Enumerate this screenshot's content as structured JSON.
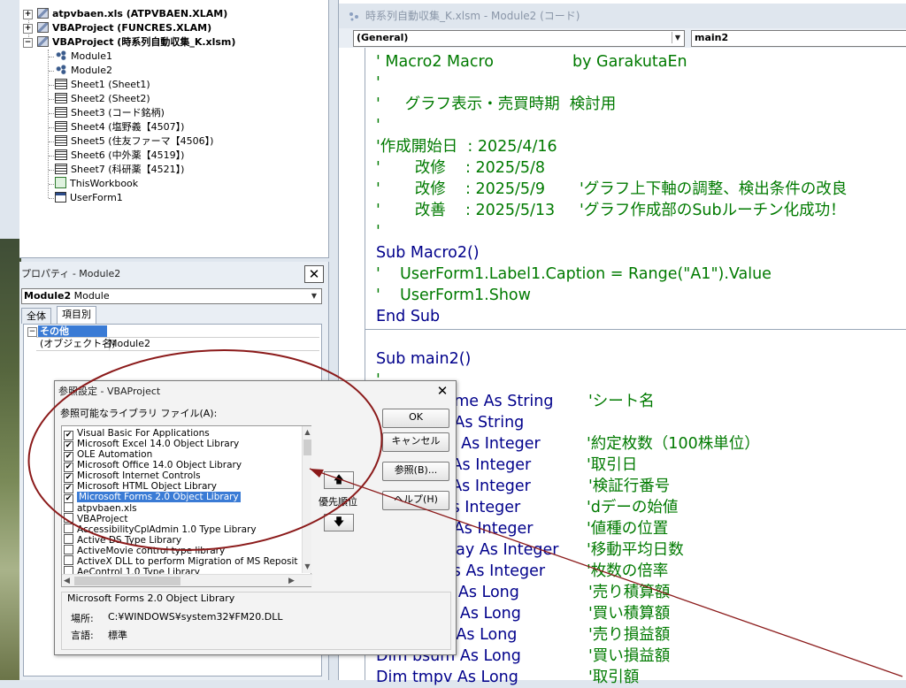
{
  "project_tree": {
    "projects": [
      {
        "label": "atpvbaen.xls (ATPVBAEN.XLAM)",
        "expander": "+"
      },
      {
        "label": "VBAProject (FUNCRES.XLAM)",
        "expander": "+"
      },
      {
        "label": "VBAProject (時系列自動収集_K.xlsm)",
        "expander": "−"
      }
    ],
    "items": [
      {
        "label": "Module1",
        "icon": "module-icon"
      },
      {
        "label": "Module2",
        "icon": "module-icon"
      },
      {
        "label": "Sheet1 (Sheet1)",
        "icon": "sheet-icon"
      },
      {
        "label": "Sheet2 (Sheet2)",
        "icon": "sheet-icon"
      },
      {
        "label": "Sheet3 (コード銘柄)",
        "icon": "sheet-icon"
      },
      {
        "label": "Sheet4 (塩野義【4507】)",
        "icon": "sheet-icon"
      },
      {
        "label": "Sheet5 (住友ファーマ【4506】)",
        "icon": "sheet-icon"
      },
      {
        "label": "Sheet6 (中外薬【4519】)",
        "icon": "sheet-icon"
      },
      {
        "label": "Sheet7 (科研薬【4521】)",
        "icon": "sheet-icon"
      },
      {
        "label": "ThisWorkbook",
        "icon": "workbook-icon"
      },
      {
        "label": "UserForm1",
        "icon": "userform-icon"
      }
    ]
  },
  "properties": {
    "title": "プロパティ - Module2",
    "close": "✕",
    "object_name": "Module2",
    "object_type": "Module",
    "tabs": [
      "全体",
      "項目別"
    ],
    "category": "その他",
    "category_expander": "−",
    "row_name": "(オブジェクト名)",
    "row_value": "Module2"
  },
  "code_window": {
    "title": "時系列自動収集_K.xlsm - Module2 (コード)",
    "object_combo": "(General)",
    "proc_combo": "main2",
    "lines": [
      {
        "text": "' Macro2 Macro                by GarakutaEn",
        "kind": "comment"
      },
      {
        "text": "'",
        "kind": "comment"
      },
      {
        "text": "'     グラフ表示・売買時期  検討用",
        "kind": "comment"
      },
      {
        "text": "'",
        "kind": "comment"
      },
      {
        "text": "'作成開始日  : 2025/4/16",
        "kind": "comment"
      },
      {
        "text": "'       改修    : 2025/5/8",
        "kind": "comment"
      },
      {
        "text": "'       改修    : 2025/5/9       'グラフ上下軸の調整、検出条件の改良",
        "kind": "comment"
      },
      {
        "text": "'       改善    : 2025/5/13     'グラフ作成部のSubルーチン化成功！",
        "kind": "comment"
      },
      {
        "text": "'",
        "kind": "comment"
      },
      {
        "text": "Sub Macro2()",
        "kind": "code"
      },
      {
        "text": "'    UserForm1.Label1.Caption = Range(\"A1\").Value",
        "kind": "comment"
      },
      {
        "text": "'    UserForm1.Show",
        "kind": "comment"
      },
      {
        "text": "End Sub",
        "kind": "code"
      },
      {
        "text": "Sub main2()",
        "kind": "code"
      },
      {
        "text": "'",
        "kind": "comment"
      },
      {
        "text": "Dim wsName As String",
        "kind": "code",
        "comment": "'シート名"
      },
      {
        "text": "Dim tmpt As String",
        "kind": "code",
        "comment": ""
      },
      {
        "text": "Dim vnum As Integer",
        "kind": "code",
        "comment": "'約定枚数（100株単位）"
      },
      {
        "text": "Dim tday As Integer",
        "kind": "code",
        "comment": "'取引日"
      },
      {
        "text": "Dim trow As Integer",
        "kind": "code",
        "comment": "'検証行番号"
      },
      {
        "text": "Dim dst As Integer",
        "kind": "code",
        "comment": "'dデーの始値"
      },
      {
        "text": "Dim vpos As Integer",
        "kind": "code",
        "comment": "'値種の位置"
      },
      {
        "text": "Dim mavday As Integer",
        "kind": "code",
        "comment": "'移動平均日数"
      },
      {
        "text": "Dim mtims As Integer",
        "kind": "code",
        "comment": "'枚数の倍率"
      },
      {
        "text": "Dim ssum As Long",
        "kind": "code",
        "comment": "'売り積算額"
      },
      {
        "text": "Dim bsum As Long",
        "kind": "code",
        "comment": "'買い積算額"
      },
      {
        "text": "Dim sprof As Long",
        "kind": "code",
        "comment": "'売り損益額"
      },
      {
        "text": "Dim bsum As Long",
        "kind": "code",
        "comment": "'買い損益額"
      },
      {
        "text": "Dim tmpv As Long",
        "kind": "code",
        "comment": "'取引額"
      }
    ]
  },
  "references_dialog": {
    "title": "参照設定 - VBAProject",
    "close": "✕",
    "list_label": "参照可能なライブラリ ファイル(A):",
    "references": [
      {
        "name": "Visual Basic For Applications",
        "checked": true
      },
      {
        "name": "Microsoft Excel 14.0 Object Library",
        "checked": true
      },
      {
        "name": "OLE Automation",
        "checked": true
      },
      {
        "name": "Microsoft Office 14.0 Object Library",
        "checked": true
      },
      {
        "name": "Microsoft Internet Controls",
        "checked": true
      },
      {
        "name": "Microsoft HTML Object Library",
        "checked": true
      },
      {
        "name": "Microsoft Forms 2.0 Object Library",
        "checked": true,
        "selected": true
      },
      {
        "name": "atpvbaen.xls",
        "checked": false
      },
      {
        "name": "VBAProject",
        "checked": false
      },
      {
        "name": "AccessibilityCplAdmin 1.0 Type Library",
        "checked": false
      },
      {
        "name": "Active DS Type Library",
        "checked": false
      },
      {
        "name": "ActiveMovie control type library",
        "checked": false
      },
      {
        "name": "ActiveX DLL to perform Migration of MS Reposit",
        "checked": false
      },
      {
        "name": "AeControl 1.0 Type Library",
        "checked": false
      }
    ],
    "buttons": {
      "ok": "OK",
      "cancel": "キャンセル",
      "browse": "参照(B)...",
      "help": "ヘルプ(H)"
    },
    "priority_label": "優先順位",
    "priority_up": "🡅",
    "priority_down": "🡇",
    "selected_group_title": "Microsoft Forms 2.0 Object Library",
    "location_label": "場所:",
    "location_value": "C:¥WINDOWS¥system32¥FM20.DLL",
    "language_label": "言語:",
    "language_value": "標準"
  },
  "colors": {
    "code_keyword": "#00008b",
    "code_comment": "#007a00",
    "selection": "#3a7bd5",
    "annotation": "#8b1a1a"
  }
}
